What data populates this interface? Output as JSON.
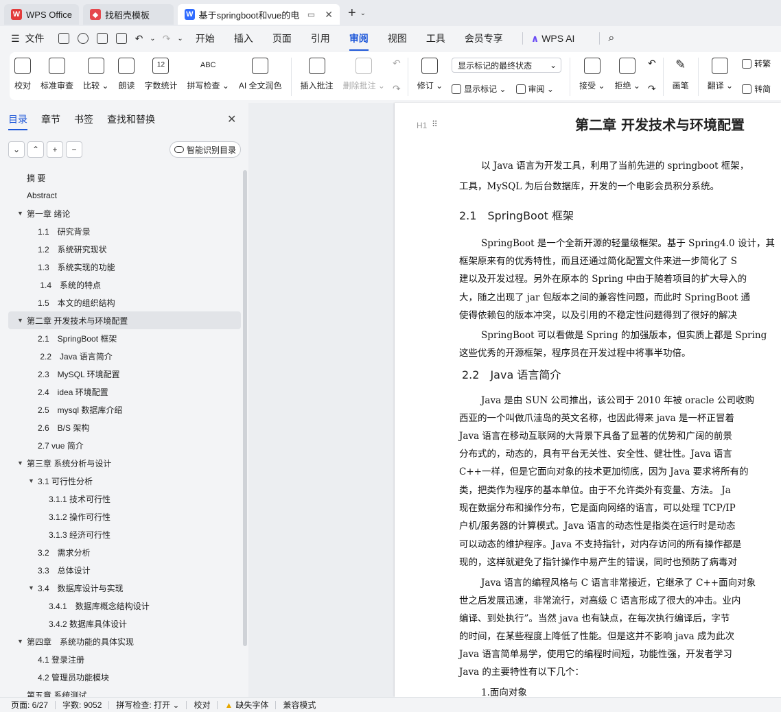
{
  "titlebar": {
    "tabs": [
      {
        "label": "WPS Office",
        "icon": "wps-logo-icon"
      },
      {
        "label": "找稻壳模板",
        "icon": "template-logo-icon"
      },
      {
        "label": "基于springboot和vue的电影",
        "icon": "doc-logo-icon"
      }
    ]
  },
  "menubar": {
    "file": "文件",
    "items": [
      "开始",
      "插入",
      "页面",
      "引用",
      "审阅",
      "视图",
      "工具",
      "会员专享"
    ],
    "active": "审阅",
    "ai": "WPS AI"
  },
  "ribbon": {
    "proofread": "校对",
    "standard_review": "标准审查",
    "compare": "比较",
    "read_aloud": "朗读",
    "word_count": "字数统计",
    "spell_check": "拼写检查",
    "ai_proof": "AI 全文润色",
    "insert_comment": "插入批注",
    "delete_comment": "删除批注",
    "track_changes": "修订",
    "markup_dropdown": "显示标记的最终状态",
    "show_markup": "显示标记",
    "review": "审阅",
    "accept": "接受",
    "reject": "拒绝",
    "pen": "画笔",
    "translate": "翻译",
    "to_traditional": "转繁",
    "to_simplified": "转简",
    "word_count_icon_text": "12",
    "spell_icon_text": "ABC"
  },
  "sidebar": {
    "tabs": [
      "目录",
      "章节",
      "书签",
      "查找和替换"
    ],
    "active_tab": "目录",
    "smart_button": "智能识别目录",
    "toc": [
      {
        "label": "摘 要",
        "level": 0,
        "expand": ""
      },
      {
        "label": "Abstract",
        "level": 0,
        "expand": ""
      },
      {
        "label": "第一章 绪论",
        "level": 0,
        "expand": "▼"
      },
      {
        "label": "1.1　研究背景",
        "level": 1,
        "expand": ""
      },
      {
        "label": "1.2　系统研究现状",
        "level": 1,
        "expand": ""
      },
      {
        "label": "1.3　系统实现的功能",
        "level": 1,
        "expand": ""
      },
      {
        "label": " 1.4　系统的特点",
        "level": 1,
        "expand": ""
      },
      {
        "label": "1.5　本文的组织结构",
        "level": 1,
        "expand": ""
      },
      {
        "label": "第二章 开发技术与环境配置",
        "level": 0,
        "expand": "▼"
      },
      {
        "label": "2.1　SpringBoot 框架",
        "level": 1,
        "expand": ""
      },
      {
        "label": " 2.2　Java 语言简介",
        "level": 1,
        "expand": ""
      },
      {
        "label": "2.3　MySQL 环境配置",
        "level": 1,
        "expand": ""
      },
      {
        "label": "2.4　idea 环境配置",
        "level": 1,
        "expand": ""
      },
      {
        "label": "2.5　mysql 数据库介绍",
        "level": 1,
        "expand": ""
      },
      {
        "label": "2.6　B/S 架构",
        "level": 1,
        "expand": ""
      },
      {
        "label": "2.7 vue 简介",
        "level": 1,
        "expand": ""
      },
      {
        "label": "第三章 系统分析与设计",
        "level": 0,
        "expand": "▼"
      },
      {
        "label": "3.1 可行性分析",
        "level": 1,
        "expand": "▼"
      },
      {
        "label": "3.1.1 技术可行性",
        "level": 2,
        "expand": ""
      },
      {
        "label": "3.1.2 操作可行性",
        "level": 2,
        "expand": ""
      },
      {
        "label": "3.1.3 经济可行性",
        "level": 2,
        "expand": ""
      },
      {
        "label": "3.2　需求分析",
        "level": 1,
        "expand": ""
      },
      {
        "label": "3.3　总体设计",
        "level": 1,
        "expand": ""
      },
      {
        "label": "3.4　数据库设计与实现",
        "level": 1,
        "expand": "▼"
      },
      {
        "label": "3.4.1　数据库概念结构设计",
        "level": 2,
        "expand": ""
      },
      {
        "label": "3.4.2 数据库具体设计",
        "level": 2,
        "expand": ""
      },
      {
        "label": "第四章　系统功能的具体实现",
        "level": 0,
        "expand": "▼"
      },
      {
        "label": "4.1 登录注册",
        "level": 1,
        "expand": ""
      },
      {
        "label": "4.2 管理员功能模块",
        "level": 1,
        "expand": ""
      },
      {
        "label": "第五章 系统测试",
        "level": 0,
        "expand": ""
      }
    ],
    "selected_index": 8
  },
  "document": {
    "heading": "第二章 开发技术与环境配置",
    "heading_marker": "H1",
    "lines": [
      {
        "text": "以 Java 语言为开发工具，利用了当前先进的 springboot 框架，",
        "indent": true,
        "kind": "p"
      },
      {
        "text": "工具，MySQL 为后台数据库，开发的一个电影会员积分系统。",
        "indent": false,
        "kind": "p"
      },
      {
        "text": "2.1　SpringBoot 框架",
        "kind": "h2"
      },
      {
        "text": "SpringBoot 是一个全新开源的轻量级框架。基于 Spring4.0 设计，其",
        "indent": true,
        "kind": "p"
      },
      {
        "text": "框架原来有的优秀特性，而且还通过简化配置文件来进一步简化了 S",
        "indent": false,
        "kind": "p"
      },
      {
        "text": "建以及开发过程。另外在原本的 Spring 中由于随着项目的扩大导入的",
        "indent": false,
        "kind": "p"
      },
      {
        "text": "大，随之出现了 jar 包版本之间的兼容性问题，而此时 SpringBoot 通",
        "indent": false,
        "kind": "p"
      },
      {
        "text": "使得依赖包的版本冲突，以及引用的不稳定性问题得到了很好的解决",
        "indent": false,
        "kind": "p"
      },
      {
        "text": "SpringBoot 可以看做是 Spring 的加强版本，但实质上都是 Spring",
        "indent": true,
        "kind": "p"
      },
      {
        "text": "这些优秀的开源框架，程序员在开发过程中将事半功倍。",
        "indent": false,
        "kind": "p"
      },
      {
        "text": "2.2　Java 语言简介",
        "kind": "h2"
      },
      {
        "text": "Java 是由 SUN 公司推出，该公司于 2010 年被 oracle 公司收购",
        "indent": true,
        "kind": "p"
      },
      {
        "text": "西亚的一个叫做爪洼岛的英文名称，也因此得来 java 是一杯正冒着",
        "indent": false,
        "kind": "p"
      },
      {
        "text": "Java 语言在移动互联网的大背景下具备了显著的优势和广阔的前景",
        "indent": false,
        "kind": "p"
      },
      {
        "text": "分布式的，动态的，具有平台无关性、安全性、健壮性。Java 语言",
        "indent": false,
        "kind": "p"
      },
      {
        "text": "C++一样，但是它面向对象的技术更加彻底，因为 Java 要求将所有的",
        "indent": false,
        "kind": "p"
      },
      {
        "text": "类，把类作为程序的基本单位。由于不允许类外有变量、方法。 Ja",
        "indent": false,
        "kind": "p"
      },
      {
        "text": "现在数据分布和操作分布，它是面向网络的语言，可以处理 TCP/IP",
        "indent": false,
        "kind": "p"
      },
      {
        "text": "户机/服务器的计算模式。Java 语言的动态性是指类在运行时是动态",
        "indent": false,
        "kind": "p"
      },
      {
        "text": "可以动态的维护程序。Java 不支持指针，对内存访问的所有操作都是",
        "indent": false,
        "kind": "p"
      },
      {
        "text": "现的，这样就避免了指针操作中易产生的错误，同时也预防了病毒对",
        "indent": false,
        "kind": "p"
      },
      {
        "text": "Java 语言的编程风格与 C 语言非常接近，它继承了 C++面向对象",
        "indent": true,
        "kind": "p"
      },
      {
        "text": "世之后发展迅速，非常流行，对高级 C 语言形成了很大的冲击。业内",
        "indent": false,
        "kind": "p"
      },
      {
        "text": "编译、到处执行”。当然 java 也有缺点，在每次执行编译后，字节",
        "indent": false,
        "kind": "p"
      },
      {
        "text": "的时间，在某些程度上降低了性能。但是这并不影响 java 成为此次",
        "indent": false,
        "kind": "p"
      },
      {
        "text": "Java 语言简单易学，使用它的编程时间短，功能性强，开发者学习",
        "indent": false,
        "kind": "p"
      },
      {
        "text": "Java 的主要特性有以下几个：",
        "indent": false,
        "kind": "p"
      },
      {
        "text": "1.面向对象",
        "indent": true,
        "kind": "p"
      }
    ]
  },
  "statusbar": {
    "page": "页面: 6/27",
    "words": "字数: 9052",
    "spell": "拼写检查: 打开",
    "proof": "校对",
    "missing_font": "缺失字体",
    "compat": "兼容模式"
  },
  "colors": {
    "accent": "#1c56d8",
    "wps_red": "#e23b3b",
    "doc_blue": "#2f6bff"
  }
}
